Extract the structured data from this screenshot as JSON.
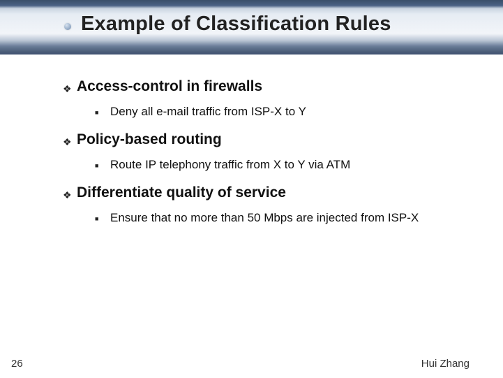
{
  "title": "Example of Classification Rules",
  "bullets": [
    {
      "heading": "Access-control in firewalls",
      "sub": "Deny all e-mail traffic from ISP-X to Y"
    },
    {
      "heading": "Policy-based routing",
      "sub": "Route IP telephony traffic from X to Y via ATM"
    },
    {
      "heading": "Differentiate quality of service",
      "sub": "Ensure that no more than 50 Mbps are injected from ISP-X"
    }
  ],
  "page_number": "26",
  "author": "Hui Zhang"
}
